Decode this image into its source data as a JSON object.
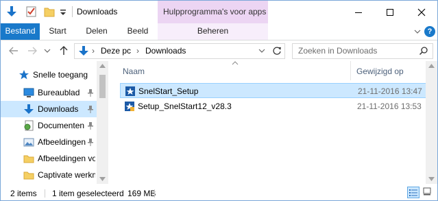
{
  "window": {
    "title": "Downloads",
    "context_tab_title": "Hulpprogramma's voor apps"
  },
  "ribbon": {
    "tabs": [
      "Bestand",
      "Start",
      "Delen",
      "Beeld",
      "Beheren"
    ],
    "help_label": "?"
  },
  "address": {
    "crumbs": [
      "Deze pc",
      "Downloads"
    ],
    "search_placeholder": "Zoeken in Downloads"
  },
  "sidebar": {
    "items": [
      {
        "label": "Snelle toegang",
        "icon": "star-icon",
        "pinned": false
      },
      {
        "label": "Bureaublad",
        "icon": "desktop-icon",
        "pinned": true
      },
      {
        "label": "Downloads",
        "icon": "download-icon",
        "pinned": true,
        "selected": true
      },
      {
        "label": "Documenten",
        "icon": "documents-icon",
        "pinned": true
      },
      {
        "label": "Afbeeldingen",
        "icon": "pictures-icon",
        "pinned": true
      },
      {
        "label": "Afbeeldingen vo",
        "icon": "folder-icon",
        "pinned": false
      },
      {
        "label": "Captivate werkm",
        "icon": "folder-icon",
        "pinned": false
      }
    ]
  },
  "list": {
    "columns": {
      "name": "Naam",
      "modified": "Gewijzigd op"
    },
    "files": [
      {
        "name": "SnelStart_Setup",
        "modified": "21-11-2016 13:47",
        "selected": true
      },
      {
        "name": "Setup_SnelStart12_v28.3",
        "modified": "21-11-2016 13:53",
        "selected": false
      }
    ]
  },
  "status": {
    "item_count": "2 items",
    "selection": "1 item geselecteerd",
    "size": "169 MB"
  },
  "colors": {
    "accent": "#1979ca",
    "selection": "#cce8ff",
    "context_tab": "#ecd5f3"
  }
}
